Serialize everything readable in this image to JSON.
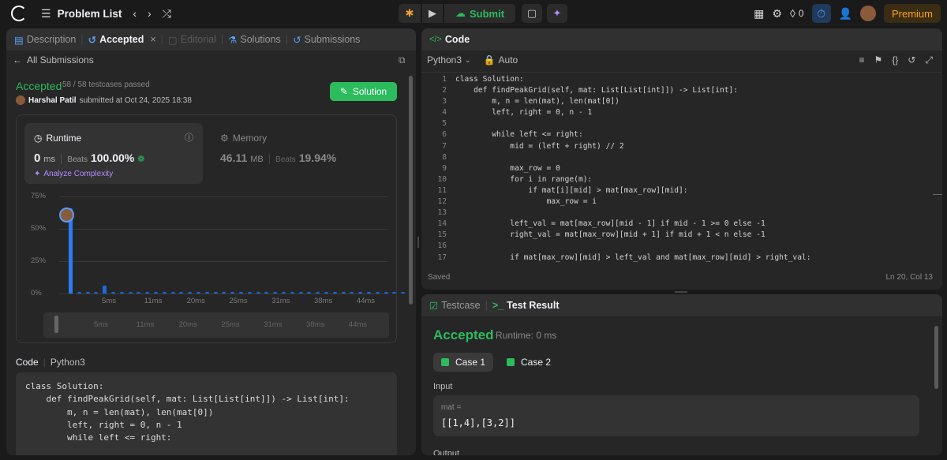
{
  "topbar": {
    "title": "Problem List",
    "submit_label": "Submit",
    "fire_count": "0",
    "premium_label": "Premium"
  },
  "left_tabs": [
    "Description",
    "Accepted",
    "Editorial",
    "Solutions",
    "Submissions"
  ],
  "back_label": "All Submissions",
  "result": {
    "status": "Accepted",
    "passed": "58 / 58 testcases passed",
    "user": "Harshal Patil",
    "submitted": "submitted at Oct 24, 2025 18:38",
    "solution_button": "Solution"
  },
  "runtime": {
    "label": "Runtime",
    "value": "0",
    "unit": "ms",
    "beats_label": "Beats",
    "beats": "100.00%",
    "analyze": "Analyze Complexity"
  },
  "memory": {
    "label": "Memory",
    "value": "46.11",
    "unit": "MB",
    "beats_label": "Beats",
    "beats": "19.94%"
  },
  "chart_data": {
    "type": "bar",
    "ylabel_ticks": [
      "75%",
      "50%",
      "25%",
      "0%"
    ],
    "x_ticks": [
      "5ms",
      "11ms",
      "20ms",
      "25ms",
      "31ms",
      "38ms",
      "44ms"
    ],
    "values": [
      66,
      1.5,
      1.5,
      1.5,
      6,
      1.5,
      1.5,
      1.5,
      1.5,
      1.5,
      1.5,
      1.5,
      1.5,
      1.5,
      1.5,
      1.5,
      1.5,
      1.5,
      1.5,
      1.5,
      1.5,
      1.5,
      1.5,
      1.5,
      1.5,
      1.5,
      1.5,
      1.5,
      1.5,
      1.5,
      1.5,
      1.5,
      1.5,
      1.5,
      1.5,
      1.5,
      1.5,
      1.5,
      1.5,
      1.5
    ],
    "ylim": [
      0,
      75
    ]
  },
  "code_section": {
    "label": "Code",
    "lang": "Python3"
  },
  "left_code": [
    "class Solution:",
    "    def findPeakGrid(self, mat: List[List[int]]) -> List[int]:",
    "        m, n = len(mat), len(mat[0])",
    "        left, right = 0, n - 1",
    "",
    "        while left <= right:"
  ],
  "editor": {
    "title": "Code",
    "lang": "Python3",
    "mode": "Auto",
    "status": "Saved",
    "cursor": "Ln 20, Col 13",
    "lines": [
      "class Solution:",
      "    def findPeakGrid(self, mat: List[List[int]]) -> List[int]:",
      "        m, n = len(mat), len(mat[0])",
      "        left, right = 0, n - 1",
      "",
      "        while left <= right:",
      "            mid = (left + right) // 2",
      "",
      "            max_row = 0",
      "            for i in range(m):",
      "                if mat[i][mid] > mat[max_row][mid]:",
      "                    max_row = i",
      "",
      "            left_val = mat[max_row][mid - 1] if mid - 1 >= 0 else -1",
      "            right_val = mat[max_row][mid + 1] if mid + 1 < n else -1",
      "",
      "            if mat[max_row][mid] > left_val and mat[max_row][mid] > right_val:"
    ]
  },
  "test": {
    "tab1": "Testcase",
    "tab2": "Test Result",
    "status": "Accepted",
    "runtime": "Runtime: 0 ms",
    "case1": "Case 1",
    "case2": "Case 2",
    "input_label": "Input",
    "var": "mat =",
    "value": "[[1,4],[3,2]]",
    "output_label": "Output"
  }
}
